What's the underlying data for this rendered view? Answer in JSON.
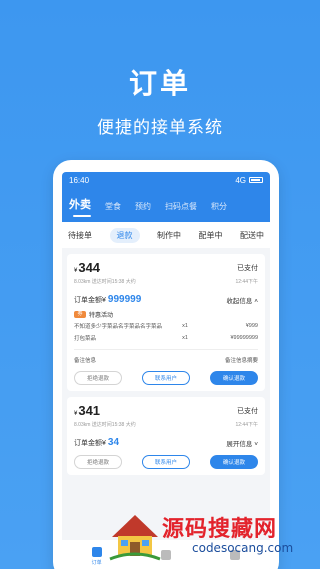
{
  "headline": "订单",
  "subline": "便捷的接单系统",
  "phone": {
    "status": {
      "time": "16:40",
      "signal": "4G"
    },
    "main_tabs": [
      "外卖",
      "堂食",
      "预约",
      "扫码点餐",
      "积分"
    ],
    "sub_tabs": [
      "待接单",
      "退款",
      "制作中",
      "配单中",
      "配送中"
    ],
    "orders": [
      {
        "currency": "¥",
        "price": "344",
        "status": "已支付",
        "distance": "8.03km",
        "eta": "送达时间15:38 大约",
        "time": "12:44下午",
        "total_label": "订单金额",
        "total_currency": "¥",
        "total": "999999",
        "detail_label": "收起信息",
        "tag_icon": "券",
        "tag": "特惠活动",
        "items": [
          {
            "name": "不知道多少字菜品名字菜品名字菜品",
            "qty": "x1",
            "amount": "¥999"
          },
          {
            "name": "打包菜品",
            "qty": "x1",
            "amount": "¥99999999"
          }
        ],
        "remark_label": "备注信息",
        "remark_value": "备注信息摘要",
        "buttons": [
          "拒绝退款",
          "联系用户",
          "确认退款"
        ]
      },
      {
        "currency": "¥",
        "price": "341",
        "status": "已支付",
        "distance": "8.03km",
        "eta": "送达时间15:38 大约",
        "time": "12:44下午",
        "total_label": "订单金额",
        "total_currency": "¥",
        "total": "34",
        "detail_label": "展开信息",
        "buttons": [
          "拒绝退款",
          "联系用户",
          "确认退款"
        ]
      }
    ],
    "bottom_nav": [
      "订单",
      "",
      ""
    ]
  },
  "watermark": {
    "title": "源码搜藏网",
    "site": "codesocang.com"
  },
  "colors": {
    "background": "#3d97f0",
    "accent": "#2e86ea",
    "watermark_red": "#e3232c"
  }
}
